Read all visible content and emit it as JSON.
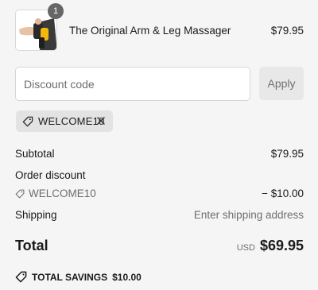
{
  "product": {
    "quantity": "1",
    "name": "The Original Arm & Leg Massager",
    "price": "$79.95"
  },
  "discount": {
    "placeholder": "Discount code",
    "value": "",
    "apply_label": "Apply"
  },
  "applied_code": {
    "label": "WELCOME10",
    "icon": "tag-icon"
  },
  "summary": {
    "subtotal_label": "Subtotal",
    "subtotal_value": "$79.95",
    "order_discount_label": "Order discount",
    "discount_code": "WELCOME10",
    "discount_value": "− $10.00",
    "shipping_label": "Shipping",
    "shipping_value": "Enter shipping address",
    "total_label": "Total",
    "total_currency": "USD",
    "total_value": "$69.95",
    "savings_label": "TOTAL SAVINGS",
    "savings_value": "$10.00"
  },
  "colors": {
    "background": "#f5f5f5",
    "chip": "#e3e3e3",
    "apply_button": "#e8e8e8",
    "badge": "#666666",
    "massager_accent": "#f2b90c"
  }
}
